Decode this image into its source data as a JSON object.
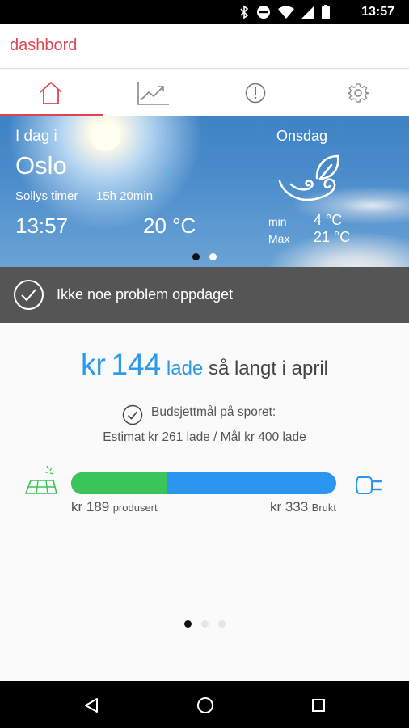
{
  "status_bar": {
    "time": "13:57"
  },
  "app_bar": {
    "title": "dashbord"
  },
  "tabs": [
    {
      "name": "home",
      "icon": "home-icon",
      "active": true
    },
    {
      "name": "trend",
      "icon": "chart-line-icon",
      "active": false
    },
    {
      "name": "alerts",
      "icon": "alert-icon",
      "active": false
    },
    {
      "name": "settings",
      "icon": "gear-icon",
      "active": false
    }
  ],
  "weather": {
    "today_label": "I dag i",
    "city": "Oslo",
    "sun_hours_label": "Sollys timer",
    "sun_hours_value": "15h 20min",
    "time": "13:57",
    "temperature": "20 °C",
    "day": "Onsdag",
    "min_label": "min",
    "min_value": "4 °C",
    "max_label": "Max",
    "max_value": "21 °C"
  },
  "status": {
    "message": "Ikke noe problem oppdaget"
  },
  "summary": {
    "currency": "kr",
    "amount": "144",
    "amount_unit": "lade",
    "suffix": "så langt i april"
  },
  "budget": {
    "title": "Budsjettmål på sporet:",
    "detail": "Estimat kr 261 lade / Mål kr 400 lade"
  },
  "energy": {
    "produced_value": "kr 189",
    "produced_label": "produsert",
    "used_value": "kr 333",
    "used_label": "Brukt",
    "produced_fraction": 0.36,
    "colors": {
      "produced": "#39c55a",
      "used": "#2b95ef"
    }
  },
  "pager": {
    "count": 3,
    "active": 0
  }
}
